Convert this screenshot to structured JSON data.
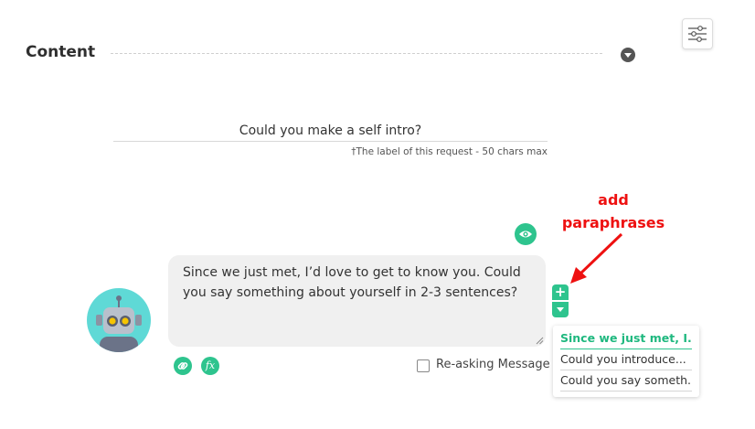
{
  "section": {
    "title": "Content"
  },
  "request_label": {
    "value": "Could you make a self intro?",
    "hint": "†The label of this request - 50 chars max"
  },
  "annotation": {
    "line1": "add",
    "line2": "paraphrases"
  },
  "message": {
    "line1": "Since we just met, I’d love to get to know you. Could",
    "line2": "you say something about yourself in 2-3 sentences?"
  },
  "stepper": {
    "plus": "+"
  },
  "tools": {
    "fx_label": "fx"
  },
  "reasking": {
    "label": "Re-asking Message",
    "checked": false
  },
  "paraphrases": [
    {
      "text": "Since we just met, I..."
    },
    {
      "text": "Could you introduce..."
    },
    {
      "text": "Could you say someth..."
    }
  ],
  "icons": {
    "filter": "sliders-icon",
    "collapse": "chevron-down-icon",
    "preview": "eye-icon",
    "link": "link-icon",
    "function": "fx-icon",
    "bot": "robot-avatar"
  },
  "colors": {
    "accent": "#2ec48e",
    "annotation": "#ee1111",
    "bubble": "#f0f0f0"
  }
}
